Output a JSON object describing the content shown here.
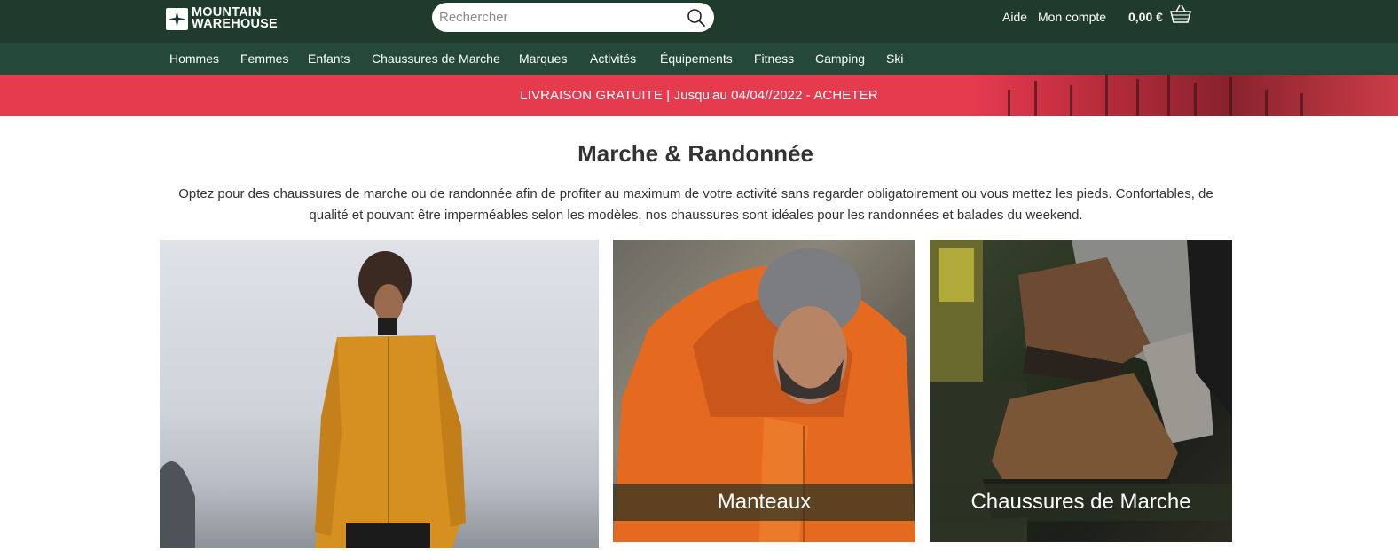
{
  "header": {
    "logo": {
      "line1": "MOUNTAIN",
      "line2": "WAREHOUSE"
    },
    "search": {
      "placeholder": "Rechercher",
      "value": ""
    },
    "help_label": "Aide",
    "account_label": "Mon compte",
    "cart_total": "0,00 €"
  },
  "nav": {
    "items": [
      {
        "label": "Hommes"
      },
      {
        "label": "Femmes"
      },
      {
        "label": "Enfants"
      },
      {
        "label": "Chaussures de Marche"
      },
      {
        "label": "Marques"
      },
      {
        "label": "Activités"
      },
      {
        "label": "Équipements"
      },
      {
        "label": "Fitness"
      },
      {
        "label": "Camping"
      },
      {
        "label": "Ski"
      }
    ]
  },
  "promo": {
    "text": "LIVRAISON GRATUITE | Jusqu'au 04/04//2022 - ACHETER"
  },
  "main": {
    "title": "Marche & Randonnée",
    "intro": "Optez pour des chaussures de marche ou de randonnée afin de profiter au maximum de votre activité sans regarder obligatoirement ou vous mettez les pieds. Confortables, de qualité et pouvant être imperméables selon les modèles, nos chaussures sont idéales pour les randonnées et balades du weekend.",
    "tiles": [
      {
        "caption": ""
      },
      {
        "caption": "Manteaux"
      },
      {
        "caption": "Chaussures de Marche"
      }
    ]
  },
  "colors": {
    "header_bg": "#1e3b2c",
    "nav_bg": "#24483a",
    "promo_bg": "#e63a4e"
  }
}
